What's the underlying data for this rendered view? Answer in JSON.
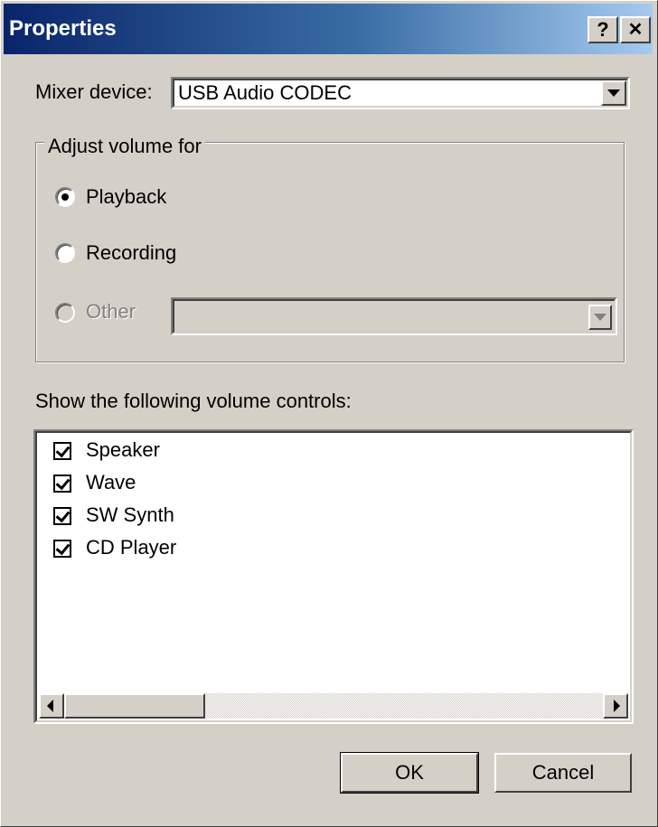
{
  "window": {
    "title": "Properties",
    "help_label": "?",
    "close_label": "✕"
  },
  "mixer": {
    "label": "Mixer device:",
    "value": "USB Audio CODEC"
  },
  "adjust": {
    "legend": "Adjust volume for",
    "options": [
      {
        "label": "Playback",
        "selected": true,
        "enabled": true
      },
      {
        "label": "Recording",
        "selected": false,
        "enabled": true
      },
      {
        "label": "Other",
        "selected": false,
        "enabled": false
      }
    ],
    "other_value": ""
  },
  "controls": {
    "label": "Show the following volume controls:",
    "items": [
      {
        "label": "Speaker",
        "checked": true
      },
      {
        "label": "Wave",
        "checked": true
      },
      {
        "label": "SW Synth",
        "checked": true
      },
      {
        "label": "CD Player",
        "checked": true
      }
    ]
  },
  "buttons": {
    "ok": "OK",
    "cancel": "Cancel"
  },
  "colors": {
    "title_start": "#0a246a",
    "title_end": "#a6caf0",
    "face": "#d4d0c8"
  }
}
